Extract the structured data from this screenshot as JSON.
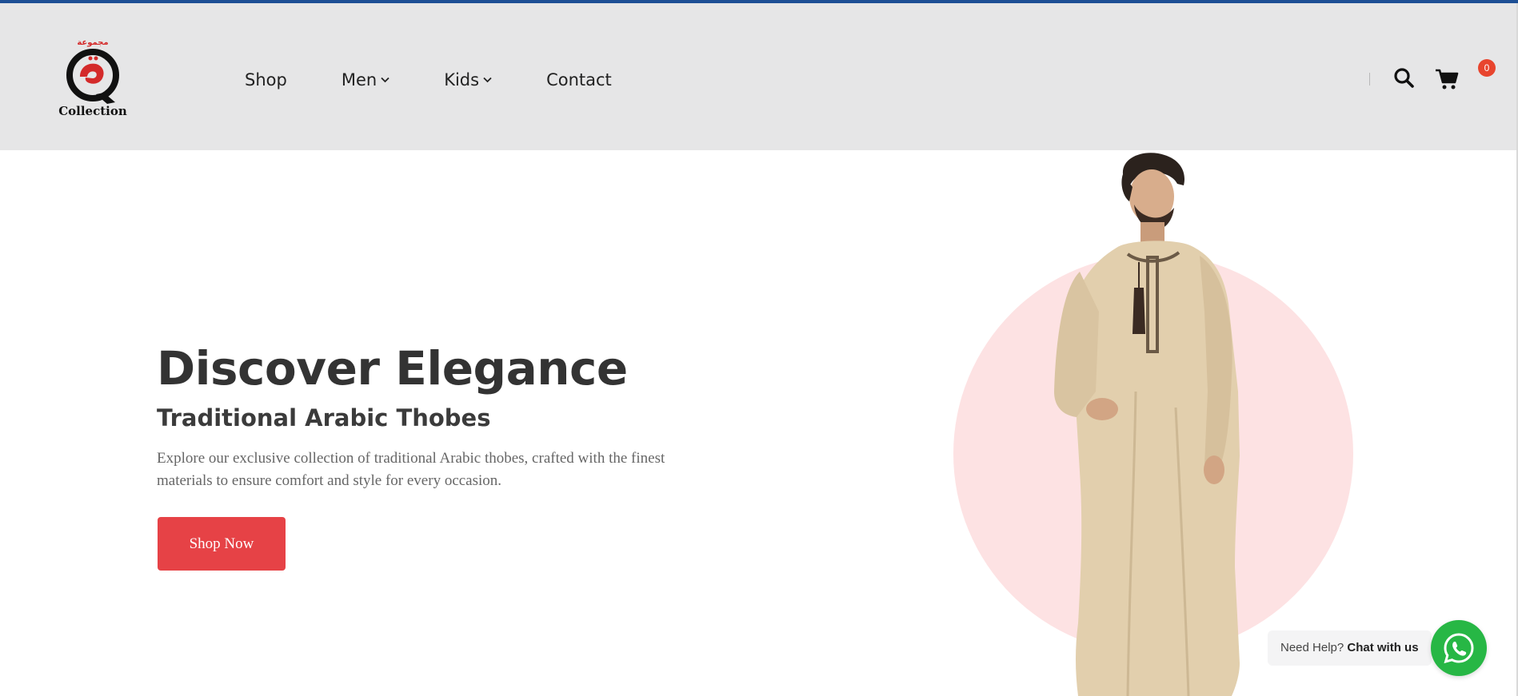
{
  "brand": {
    "arabic_text": "مجموعة",
    "logo_letter": "Q",
    "name": "Collection",
    "accent_color": "#d42a2a"
  },
  "nav": {
    "items": [
      {
        "label": "Shop",
        "has_dropdown": false
      },
      {
        "label": "Men",
        "has_dropdown": true
      },
      {
        "label": "Kids",
        "has_dropdown": true
      },
      {
        "label": "Contact",
        "has_dropdown": false
      }
    ]
  },
  "header_icons": {
    "search": "search-icon",
    "cart": "cart-icon",
    "cart_count": "0"
  },
  "hero": {
    "title": "Discover Elegance",
    "subtitle": "Traditional Arabic Thobes",
    "description": "Explore our exclusive collection of traditional Arabic thobes, crafted with the finest materials to ensure comfort and style for every occasion.",
    "cta_label": "Shop Now",
    "cta_color": "#e64246",
    "image": "model-in-beige-thobe"
  },
  "chat": {
    "prefix": "Need Help?",
    "action": "Chat with us",
    "icon": "whatsapp-icon",
    "color": "#27b745"
  },
  "colors": {
    "top_bar": "#1d4f95",
    "header_bg": "#e6e6e7",
    "circle": "#fde2e3"
  }
}
